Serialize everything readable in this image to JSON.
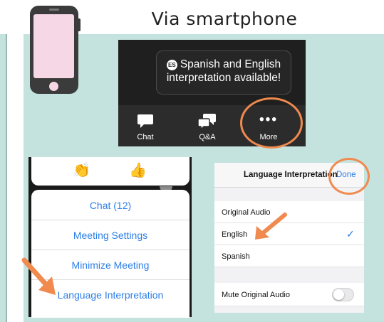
{
  "header": {
    "title": "Via smartphone"
  },
  "colors": {
    "accent_orange": "#f08a4e",
    "teal_background": "#c4e3de",
    "ios_blue": "#2d7ee6",
    "zoom_dark": "#1f1f1f"
  },
  "tooltip": {
    "badge": "ES",
    "line1": "Spanish and English",
    "line2": "interpretation available!"
  },
  "toolbar": {
    "chat_label": "Chat",
    "qa_label": "Q&A",
    "more_label": "More"
  },
  "menu": {
    "reactions": [
      "👏",
      "👍"
    ],
    "items": [
      {
        "label": "Chat (12)"
      },
      {
        "label": "Meeting Settings"
      },
      {
        "label": "Minimize Meeting"
      },
      {
        "label": "Language Interpretation"
      }
    ]
  },
  "settings": {
    "title": "Language Interpretation",
    "done_label": "Done",
    "options": [
      {
        "label": "Original Audio",
        "selected": false
      },
      {
        "label": "English",
        "selected": true
      },
      {
        "label": "Spanish",
        "selected": false
      }
    ],
    "mute_label": "Mute Original Audio",
    "mute_enabled": false
  },
  "icons": {
    "phone": "smartphone-icon",
    "chat": "chat-bubble-icon",
    "qa": "qa-bubbles-icon",
    "more": "more-dots-icon",
    "check": "checkmark-icon",
    "arrow": "orange-arrow-icon"
  }
}
